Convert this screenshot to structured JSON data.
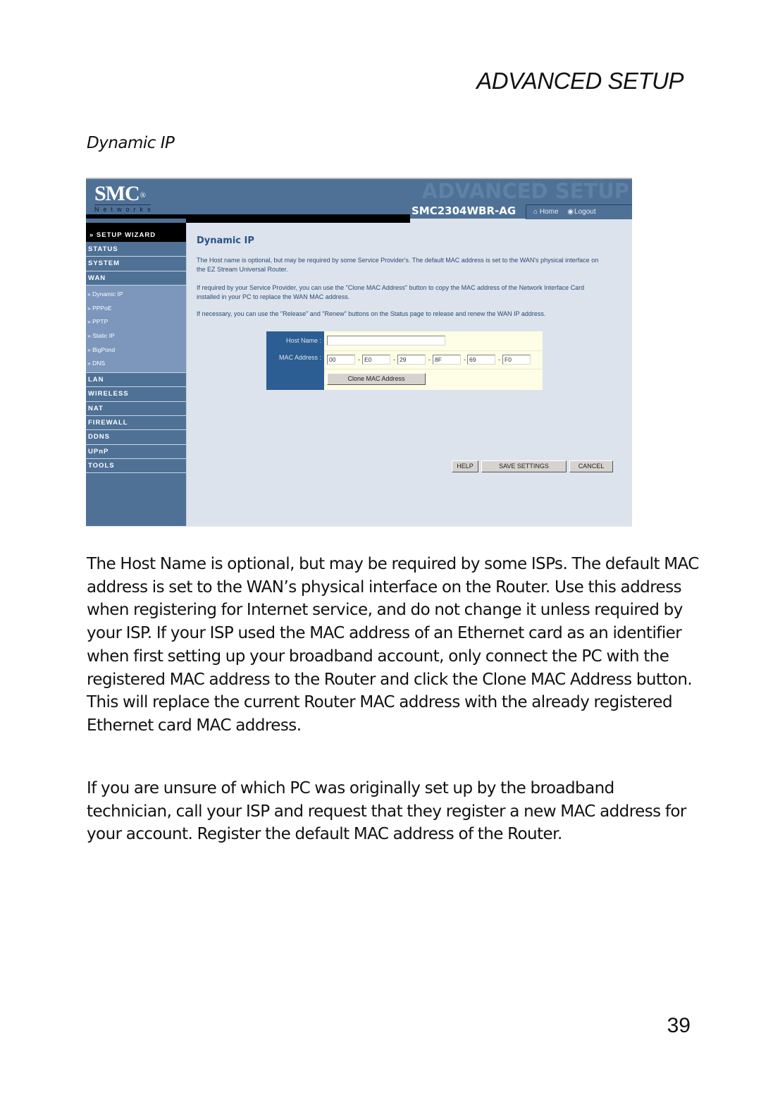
{
  "page": {
    "section_header": "ADVANCED SETUP",
    "sub_heading": "Dynamic IP",
    "page_number": "39",
    "paragraphs": [
      "The Host Name is optional, but may be required by some ISPs. The default MAC address is set to the WAN’s physical interface on the Router. Use this address when registering for Internet service, and do not change it unless required by your ISP. If your ISP used the MAC address of an Ethernet card as an identifier when first setting up your broadband account, only connect the PC with the registered MAC address to the Router and click the Clone MAC Address button. This will replace the current Router MAC address with the already registered Ethernet card MAC address.",
      "If you are unsure of which PC was originally set up by the broadband technician, call your ISP and request that they register a new MAC address for your account. Register the default MAC address of the Router."
    ]
  },
  "router_ui": {
    "logo": "SMC",
    "logo_reg": "®",
    "logo_sub": "Networks",
    "watermark": "ADVANCED SETUP",
    "model": "SMC2304WBR-AG",
    "top_links": [
      {
        "icon": "home-icon",
        "glyph": "⌂",
        "label": "Home"
      },
      {
        "icon": "logout-icon",
        "glyph": "◉",
        "label": "Logout"
      }
    ],
    "sidebar": {
      "wizard": "» SETUP WIZARD",
      "items_top": [
        "STATUS",
        "SYSTEM",
        "WAN"
      ],
      "wan_subitems": [
        "» Dynamic IP",
        "» PPPoE",
        "» PPTP",
        "» Static IP",
        "» BigPond",
        "» DNS"
      ],
      "items_bottom": [
        "LAN",
        "WIRELESS",
        "NAT",
        "FIREWALL",
        "DDNS",
        "UPnP",
        "TOOLS"
      ]
    },
    "content": {
      "title": "Dynamic IP",
      "para1": "The Host name is optional, but may be required by some Service Provider's. The default MAC address is set to the WAN's physical interface on the EZ Stream Universal Router.",
      "para2": "If required by your Service Provider, you can use the \"Clone MAC Address\" button to copy the MAC address of the Network Interface Card installed in your PC to replace the WAN MAC address.",
      "para3": "If necessary, you can use the \"Release\" and \"Renew\" buttons on the Status page to release and renew the WAN IP address."
    },
    "form": {
      "host_name_label": "Host Name :",
      "host_name_value": "",
      "mac_label": "MAC Address :",
      "mac_octets": [
        "00",
        "E0",
        "29",
        "8F",
        "69",
        "F0"
      ],
      "mac_separator": "-",
      "clone_button": "Clone MAC Address"
    },
    "buttons": {
      "help": "HELP",
      "save": "SAVE SETTINGS",
      "cancel": "CANCEL"
    }
  }
}
